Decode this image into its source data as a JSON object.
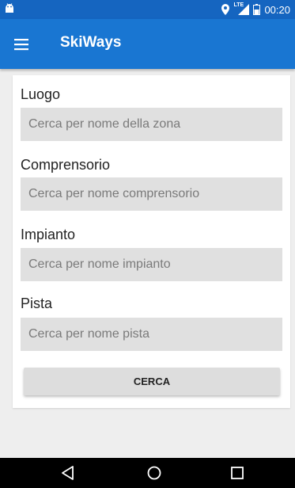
{
  "status_bar": {
    "time": "00:20",
    "network": "LTE",
    "icons": [
      "android-icon",
      "location-icon",
      "signal-icon",
      "battery-icon"
    ]
  },
  "toolbar": {
    "menu_icon": "hamburger-menu-icon",
    "title": "SkiWays"
  },
  "form": {
    "fields": [
      {
        "label": "Luogo",
        "placeholder": "Cerca per nome della zona"
      },
      {
        "label": "Comprensorio",
        "placeholder": "Cerca per nome comprensorio"
      },
      {
        "label": "Impianto",
        "placeholder": "Cerca per nome impianto"
      },
      {
        "label": "Pista",
        "placeholder": "Cerca per nome pista"
      }
    ],
    "search_button_label": "CERCA"
  },
  "nav_bar": {
    "icons": [
      "back-icon",
      "home-icon",
      "recents-icon"
    ]
  },
  "colors": {
    "status_bar": "#1565c0",
    "toolbar": "#1976d2",
    "input_background": "#e0e0e0",
    "page_background": "#eeeeee"
  }
}
